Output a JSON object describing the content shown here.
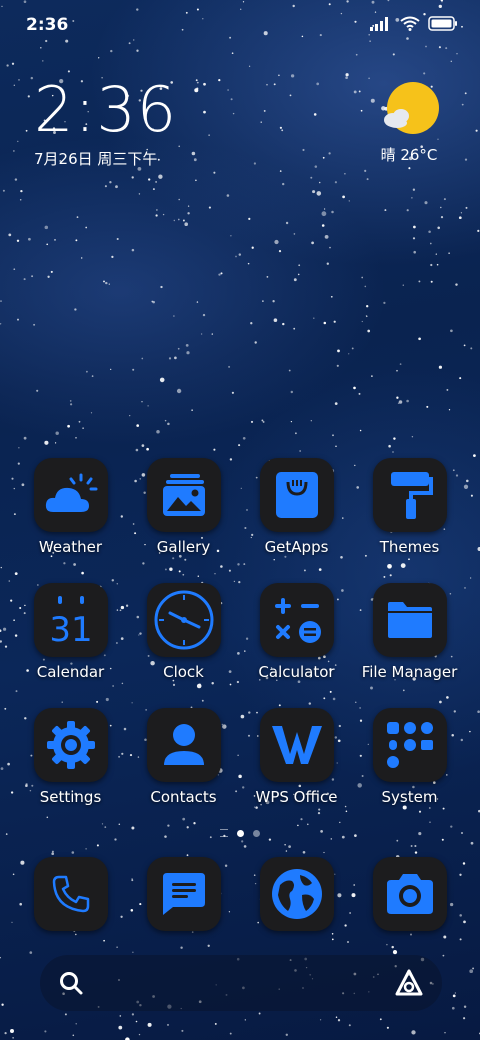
{
  "status_bar": {
    "time": "2:36"
  },
  "clock_widget": {
    "time": "2:36",
    "date": "7月26日 周三下午"
  },
  "weather_widget": {
    "text": "晴 26°C",
    "icon": "sun-cloud-icon"
  },
  "apps": [
    {
      "name": "weather",
      "label": "Weather",
      "icon": "weather-icon"
    },
    {
      "name": "gallery",
      "label": "Gallery",
      "icon": "gallery-icon"
    },
    {
      "name": "getapps",
      "label": "GetApps",
      "icon": "shopping-bag-icon"
    },
    {
      "name": "themes",
      "label": "Themes",
      "icon": "paint-roller-icon"
    },
    {
      "name": "calendar",
      "label": "Calendar",
      "icon": "calendar-icon",
      "icon_text": "31"
    },
    {
      "name": "clock",
      "label": "Clock",
      "icon": "clock-icon"
    },
    {
      "name": "calculator",
      "label": "Calculator",
      "icon": "calculator-icon"
    },
    {
      "name": "file-manager",
      "label": "File Manager",
      "icon": "folder-icon"
    },
    {
      "name": "settings",
      "label": "Settings",
      "icon": "gear-icon"
    },
    {
      "name": "contacts",
      "label": "Contacts",
      "icon": "person-icon"
    },
    {
      "name": "wps-office",
      "label": "WPS Office",
      "icon": "wps-icon"
    },
    {
      "name": "system",
      "label": "System",
      "icon": "folder-grid-icon"
    }
  ],
  "dock": [
    {
      "name": "phone",
      "icon": "phone-icon"
    },
    {
      "name": "messages",
      "icon": "message-icon"
    },
    {
      "name": "browser",
      "icon": "globe-icon"
    },
    {
      "name": "camera",
      "icon": "camera-icon"
    }
  ],
  "pages": {
    "count": 2,
    "active": 1
  },
  "search_bar": {
    "left_icon": "search-icon",
    "right_icon": "assistant-icon"
  },
  "colors": {
    "accent": "#1f7bff",
    "icon_bg": "#1c1c1e",
    "sun": "#f6c21a"
  }
}
